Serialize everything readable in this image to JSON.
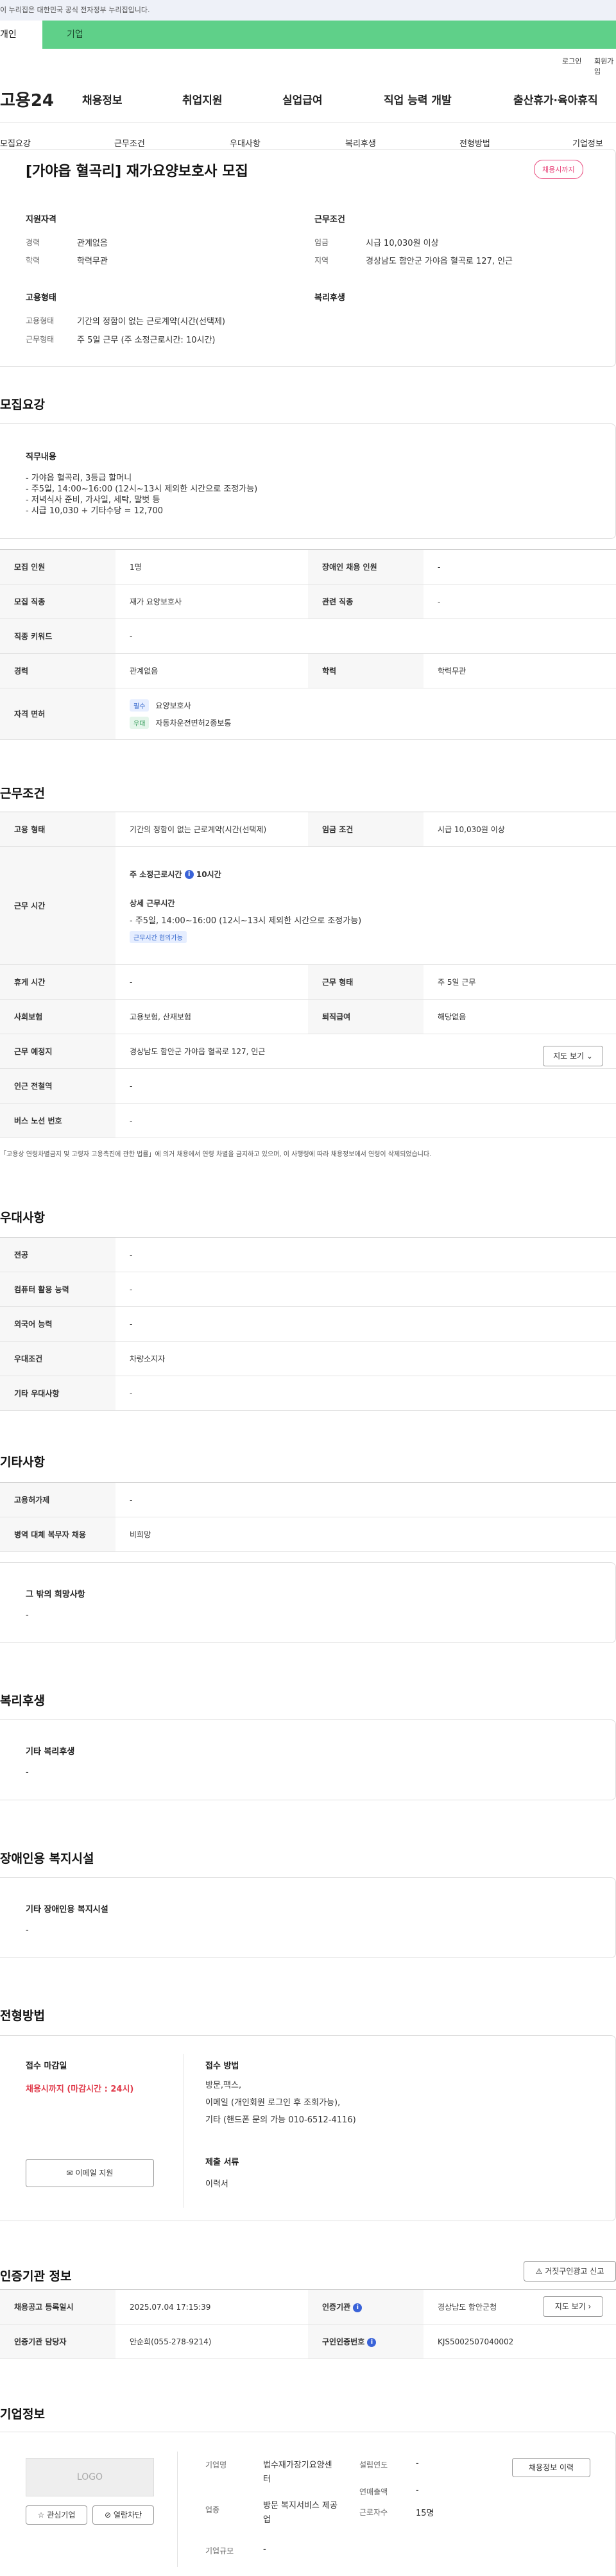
{
  "top_notice": "이 누리집은 대한민국 공식 전자정부 누리집입니다.",
  "user_tabs": {
    "individual": "개인",
    "enterprise": "기업"
  },
  "util": {
    "login": "로그인",
    "join": "회원가입"
  },
  "gnb": {
    "logo": "고용24",
    "menu": [
      "채용정보",
      "취업지원",
      "실업급여",
      "직업 능력 개발",
      "출산휴가·육아휴직"
    ]
  },
  "anchor_tabs": [
    "모집요강",
    "근무조건",
    "우대사항",
    "복리후생",
    "전형방법",
    "기업정보"
  ],
  "summary": {
    "title": "[가야읍 혈곡리] 재가요양보호사 모집",
    "badge": "채용시까지",
    "qual_title": "지원자격",
    "qual": [
      {
        "label": "경력",
        "value": "관계없음"
      },
      {
        "label": "학력",
        "value": "학력무관"
      }
    ],
    "cond_title": "근무조건",
    "cond": [
      {
        "label": "임금",
        "value": "시급 10,030원 이상"
      },
      {
        "label": "지역",
        "value": "경상남도 함안군 가야읍 혈곡로 127, 인근"
      }
    ],
    "emp_title": "고용형태",
    "emp": [
      {
        "label": "고용형태",
        "value": "기간의 정함이 없는 근로계약(시간(선택제)"
      },
      {
        "label": "근무형태",
        "value": "주 5일 근무 (주 소정근로시간: 10시간)"
      }
    ],
    "welfare_title": "복리후생"
  },
  "recruit": {
    "section_title": "모집요강",
    "duty_title": "직무내용",
    "duty_text": "- 가야읍 혈곡리, 3등급 할머니\n- 주5일, 14:00~16:00 (12시~13시 제외한 시간으로 조정가능)\n- 저녁식사 준비, 가사일, 세탁, 말벗 등\n- 시급 10,030 + 기타수당 = 12,700",
    "rows": {
      "count_label": "모집 인원",
      "count": "1명",
      "disabled_label": "장애인 채용 인원",
      "disabled": "-",
      "job_label": "모집 직종",
      "job": "재가 요양보호사",
      "related_label": "관련 직종",
      "related": "-",
      "keyword_label": "직종 키워드",
      "keyword": "-",
      "career_label": "경력",
      "career": "관계없음",
      "edu_label": "학력",
      "edu": "학력무관",
      "license_label": "자격 면허",
      "license_req_tag": "필수",
      "license_req": "요양보호사",
      "license_pref_tag": "우대",
      "license_pref": "자동차운전면허2종보통"
    }
  },
  "work": {
    "section_title": "근무조건",
    "type_label": "고용 형태",
    "type": "기간의 정함이 없는 근로계약(시간(선택제)",
    "wage_label": "임금 조건",
    "wage": "시급 10,030원 이상",
    "hours_label": "근무 시간",
    "weekly_hours": "주 소정근로시간",
    "weekly_hours_value": "10시간",
    "detail_title": "상세 근무시간",
    "detail_text": "- 주5일, 14:00~16:00 (12시~13시 제외한 시간으로 조정가능)",
    "detail_tag": "근무시간 협의가능",
    "holiday_label": "휴게 시간",
    "holiday": "-",
    "worktype_label": "근무 형태",
    "worktype": "주 5일 근무",
    "insurance_label": "사회보험",
    "insurance": "고용보험, 산재보험",
    "retire_label": "퇴직급여",
    "retire": "해당없음",
    "place_label": "근무 예정지",
    "place": "경상남도 함안군 가야읍 혈곡로 127, 인근",
    "map_button": "지도 보기",
    "subway_label": "인근 전철역",
    "subway": "-",
    "bus_label": "버스 노선 번호",
    "bus": "-",
    "note": "「고용상 연령차별금지 및 고령자 고용촉진에 관한 법률」에 의거 채용에서 연령 차별을 금지하고 있으며, 이 사행령에 따라 채용정보에서 연령이 삭제되었습니다."
  },
  "pref": {
    "section_title": "우대사항",
    "major_label": "전공",
    "major": "-",
    "computer_label": "컴퓨터 활용 능력",
    "computer": "-",
    "lang_label": "외국어 능력",
    "lang": "-",
    "cond_label": "우대조건",
    "cond": "차량소지자",
    "etc_label": "기타 우대사항",
    "etc": "-"
  },
  "etc": {
    "section_title": "기타사항",
    "employ_label": "고용허가제",
    "employ": "-",
    "military_label": "병역 대체 복무자 채용",
    "military": "비희망",
    "other_title": "그 밖의 희망사항",
    "other": "-"
  },
  "welfare": {
    "section_title": "복리후생",
    "title": "기타 복리후생",
    "value": "-"
  },
  "disabled_fac": {
    "section_title": "장애인용 복지시설",
    "title": "기타 장애인용 복지시설",
    "value": "-"
  },
  "selection": {
    "section_title": "전형방법",
    "deadline_title": "접수 마감일",
    "deadline": "채용시까지 (마감시간 : 24시)",
    "email_button": "이메일 지원",
    "method_title": "접수 방법",
    "method_text": "방문,팩스,\n이메일 (개인회원 로그인 후 조회가능),\n기타 (핸드폰 문의 가능 010-6512-4116)",
    "docs_title": "제출 서류",
    "docs": "이력서"
  },
  "cert": {
    "section_title": "인증기관 정보",
    "report_button": "거짓구인광고 신고",
    "reg_label": "채용공고 등록일시",
    "reg": "2025.07.04 17:15:39",
    "org_label": "인증기관",
    "org": "경상남도 함안군청",
    "map_button": "지도 보기",
    "manager_label": "인증기관 담당자",
    "manager": "안순희(055-278-9214)",
    "job_no_label": "구인인증번호",
    "job_no": "KJS5002507040002"
  },
  "company": {
    "section_title": "기업정보",
    "logo": "LOGO",
    "interest_button": "관심기업",
    "block_button": "열람차단",
    "name_label": "기업명",
    "name": "법수재가장기요양센터",
    "founded_label": "설립연도",
    "founded": "-",
    "industry_label": "업종",
    "industry": "방문 복지서비스 제공업",
    "sales_label": "연매출액",
    "sales": "-",
    "employees_label": "근로자수",
    "employees": "15명",
    "size_label": "기업규모",
    "size": "-",
    "resume_button": "채용정보 이력"
  }
}
